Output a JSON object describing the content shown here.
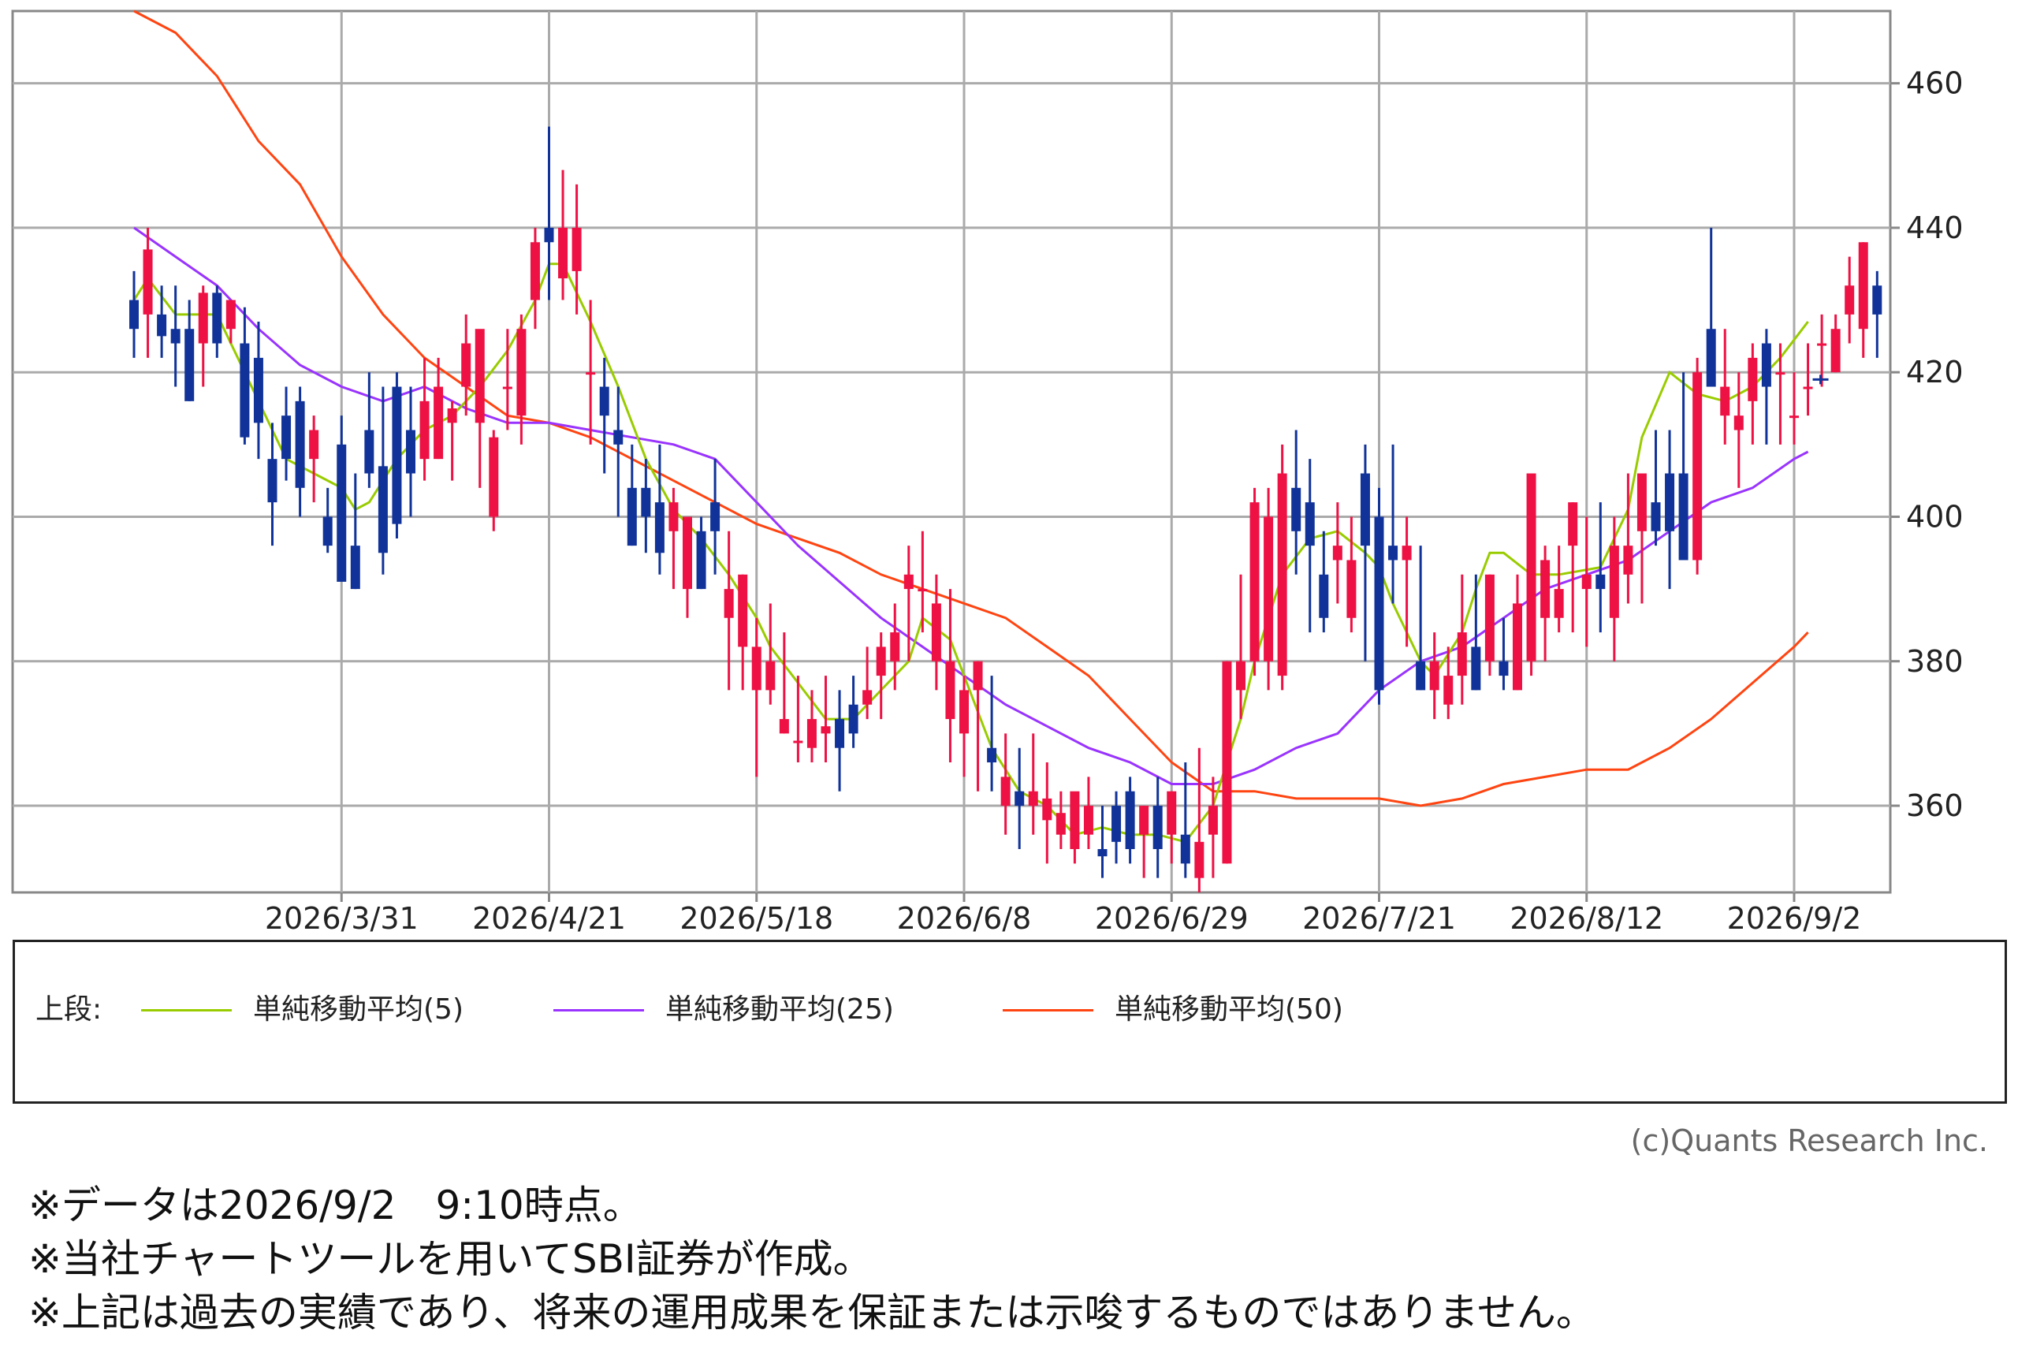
{
  "chart_data": {
    "type": "candlestick",
    "y_axis": {
      "range": [
        348,
        470
      ],
      "ticks": [
        360,
        380,
        400,
        420,
        440,
        460
      ],
      "position": "right"
    },
    "x_axis": {
      "tick_labels": [
        "2026/3/31",
        "2026/4/21",
        "2026/5/18",
        "2026/6/8",
        "2026/6/29",
        "2026/7/21",
        "2026/8/12",
        "2026/9/2"
      ],
      "tick_indices": [
        15,
        30,
        45,
        60,
        75,
        90,
        105,
        120
      ]
    },
    "grid": true,
    "colors": {
      "up": "#ee1144",
      "down": "#113399",
      "sma5": "#99cc00",
      "sma25": "#9933ff",
      "sma50": "#ff4411",
      "grid": "#aaaaaa"
    },
    "candles": [
      [
        430,
        434,
        422,
        426
      ],
      [
        428,
        440,
        422,
        437
      ],
      [
        428,
        432,
        422,
        425
      ],
      [
        426,
        432,
        418,
        424
      ],
      [
        426,
        430,
        416,
        416
      ],
      [
        424,
        432,
        418,
        431
      ],
      [
        431,
        432,
        422,
        424
      ],
      [
        426,
        430,
        424,
        430
      ],
      [
        424,
        429,
        410,
        411
      ],
      [
        422,
        427,
        408,
        413
      ],
      [
        408,
        413,
        396,
        402
      ],
      [
        414,
        418,
        405,
        408
      ],
      [
        416,
        418,
        400,
        404
      ],
      [
        408,
        414,
        402,
        412
      ],
      [
        400,
        404,
        395,
        396
      ],
      [
        410,
        414,
        396,
        391
      ],
      [
        396,
        406,
        390,
        390
      ],
      [
        412,
        420,
        404,
        406
      ],
      [
        407,
        418,
        392,
        395
      ],
      [
        418,
        420,
        397,
        399
      ],
      [
        412,
        418,
        400,
        406
      ],
      [
        408,
        422,
        405,
        416
      ],
      [
        408,
        422,
        408,
        418
      ],
      [
        413,
        416,
        405,
        415
      ],
      [
        418,
        428,
        414,
        424
      ],
      [
        413,
        424,
        404,
        426
      ],
      [
        400,
        412,
        398,
        411
      ],
      [
        418,
        426,
        412,
        418
      ],
      [
        414,
        428,
        410,
        426
      ],
      [
        430,
        440,
        426,
        438
      ],
      [
        440,
        454,
        430,
        438
      ],
      [
        433,
        448,
        430,
        440
      ],
      [
        434,
        446,
        428,
        440
      ],
      [
        420,
        430,
        410,
        420
      ],
      [
        418,
        422,
        406,
        414
      ],
      [
        412,
        418,
        400,
        410
      ],
      [
        404,
        410,
        396,
        396
      ],
      [
        404,
        408,
        395,
        400
      ],
      [
        402,
        410,
        392,
        395
      ],
      [
        398,
        404,
        390,
        402
      ],
      [
        390,
        398,
        386,
        400
      ],
      [
        398,
        400,
        390,
        390
      ],
      [
        402,
        408,
        392,
        398
      ],
      [
        386,
        398,
        376,
        390
      ],
      [
        382,
        392,
        376,
        392
      ],
      [
        376,
        386,
        364,
        382
      ],
      [
        376,
        388,
        374,
        380
      ],
      [
        370,
        384,
        370,
        372
      ],
      [
        369,
        378,
        366,
        369
      ],
      [
        368,
        376,
        366,
        372
      ],
      [
        370,
        378,
        366,
        371
      ],
      [
        372,
        376,
        362,
        368
      ],
      [
        374,
        378,
        368,
        370
      ],
      [
        374,
        382,
        372,
        376
      ],
      [
        378,
        384,
        372,
        382
      ],
      [
        380,
        388,
        376,
        384
      ],
      [
        390,
        396,
        380,
        392
      ],
      [
        390,
        398,
        384,
        390
      ],
      [
        380,
        392,
        376,
        388
      ],
      [
        372,
        390,
        366,
        380
      ],
      [
        370,
        378,
        364,
        376
      ],
      [
        376,
        380,
        362,
        380
      ],
      [
        368,
        378,
        362,
        366
      ],
      [
        360,
        370,
        356,
        364
      ],
      [
        362,
        368,
        354,
        360
      ],
      [
        360,
        370,
        356,
        362
      ],
      [
        358,
        366,
        352,
        361
      ],
      [
        356,
        362,
        354,
        359
      ],
      [
        354,
        360,
        352,
        362
      ],
      [
        356,
        364,
        354,
        360
      ],
      [
        354,
        360,
        350,
        353
      ],
      [
        360,
        362,
        352,
        355
      ],
      [
        362,
        364,
        352,
        354
      ],
      [
        356,
        360,
        350,
        360
      ],
      [
        360,
        364,
        350,
        354
      ],
      [
        356,
        362,
        352,
        362
      ],
      [
        356,
        366,
        350,
        352
      ],
      [
        350,
        368,
        348,
        355
      ],
      [
        356,
        364,
        350,
        360
      ],
      [
        352,
        380,
        352,
        380
      ],
      [
        376,
        392,
        372,
        380
      ],
      [
        380,
        404,
        378,
        402
      ],
      [
        380,
        404,
        376,
        400
      ],
      [
        378,
        410,
        376,
        406
      ],
      [
        404,
        412,
        392,
        398
      ],
      [
        402,
        408,
        384,
        396
      ],
      [
        392,
        398,
        384,
        386
      ],
      [
        394,
        402,
        388,
        396
      ],
      [
        386,
        400,
        384,
        394
      ],
      [
        406,
        410,
        380,
        396
      ],
      [
        400,
        404,
        374,
        376
      ],
      [
        396,
        410,
        388,
        394
      ],
      [
        394,
        400,
        382,
        396
      ],
      [
        380,
        396,
        376,
        376
      ],
      [
        376,
        384,
        372,
        380
      ],
      [
        374,
        382,
        372,
        378
      ],
      [
        378,
        392,
        374,
        384
      ],
      [
        382,
        392,
        376,
        376
      ],
      [
        380,
        392,
        378,
        392
      ],
      [
        380,
        386,
        376,
        378
      ],
      [
        376,
        392,
        376,
        388
      ],
      [
        380,
        396,
        378,
        406
      ],
      [
        386,
        396,
        380,
        394
      ],
      [
        386,
        396,
        384,
        390
      ],
      [
        396,
        402,
        384,
        402
      ],
      [
        390,
        400,
        382,
        392
      ],
      [
        392,
        402,
        384,
        390
      ],
      [
        386,
        400,
        380,
        396
      ],
      [
        392,
        406,
        388,
        396
      ],
      [
        398,
        404,
        388,
        406
      ],
      [
        402,
        412,
        396,
        398
      ],
      [
        406,
        412,
        390,
        398
      ],
      [
        406,
        420,
        396,
        394
      ],
      [
        394,
        422,
        392,
        420
      ],
      [
        426,
        440,
        418,
        418
      ],
      [
        414,
        426,
        410,
        418
      ],
      [
        412,
        420,
        404,
        414
      ],
      [
        416,
        424,
        410,
        422
      ],
      [
        424,
        426,
        410,
        418
      ],
      [
        420,
        424,
        410,
        420
      ],
      [
        414,
        420,
        410,
        414
      ],
      [
        418,
        424,
        414,
        418
      ],
      [
        424,
        428,
        418,
        424
      ],
      [
        420,
        428,
        420,
        426
      ],
      [
        428,
        436,
        424,
        432
      ],
      [
        426,
        438,
        422,
        438
      ],
      [
        432,
        434,
        422,
        428
      ]
    ],
    "sma5": [
      [
        0,
        430
      ],
      [
        1,
        433
      ],
      [
        3,
        428
      ],
      [
        5,
        428
      ],
      [
        6,
        428
      ],
      [
        8,
        420
      ],
      [
        10,
        412
      ],
      [
        11,
        408
      ],
      [
        13,
        406
      ],
      [
        15,
        404
      ],
      [
        16,
        401
      ],
      [
        17,
        402
      ],
      [
        19,
        408
      ],
      [
        21,
        412
      ],
      [
        23,
        414
      ],
      [
        25,
        418
      ],
      [
        27,
        423
      ],
      [
        29,
        430
      ],
      [
        30,
        435
      ],
      [
        31,
        435
      ],
      [
        33,
        427
      ],
      [
        35,
        418
      ],
      [
        37,
        408
      ],
      [
        39,
        401
      ],
      [
        41,
        397
      ],
      [
        43,
        392
      ],
      [
        45,
        386
      ],
      [
        46,
        382
      ],
      [
        48,
        377
      ],
      [
        50,
        372
      ],
      [
        52,
        372
      ],
      [
        54,
        376
      ],
      [
        56,
        380
      ],
      [
        57,
        386
      ],
      [
        59,
        383
      ],
      [
        60,
        378
      ],
      [
        61,
        373
      ],
      [
        62,
        368
      ],
      [
        64,
        362
      ],
      [
        66,
        360
      ],
      [
        68,
        356
      ],
      [
        70,
        357
      ],
      [
        72,
        356
      ],
      [
        74,
        356
      ],
      [
        76,
        355
      ],
      [
        78,
        360
      ],
      [
        80,
        372
      ],
      [
        81,
        380
      ],
      [
        83,
        392
      ],
      [
        85,
        397
      ],
      [
        87,
        398
      ],
      [
        89,
        395
      ],
      [
        90,
        393
      ],
      [
        91,
        388
      ],
      [
        92,
        384
      ],
      [
        93,
        380
      ],
      [
        94,
        378
      ],
      [
        96,
        384
      ],
      [
        97,
        390
      ],
      [
        98,
        395
      ],
      [
        99,
        395
      ],
      [
        101,
        392
      ],
      [
        103,
        392
      ],
      [
        106,
        393
      ],
      [
        108,
        401
      ],
      [
        109,
        411
      ],
      [
        111,
        420
      ],
      [
        113,
        417
      ],
      [
        115,
        416
      ],
      [
        117,
        418
      ],
      [
        119,
        422
      ],
      [
        121,
        427
      ]
    ],
    "sma25": [
      [
        0,
        440
      ],
      [
        3,
        436
      ],
      [
        6,
        432
      ],
      [
        9,
        426
      ],
      [
        12,
        421
      ],
      [
        15,
        418
      ],
      [
        18,
        416
      ],
      [
        21,
        418
      ],
      [
        24,
        415
      ],
      [
        27,
        413
      ],
      [
        30,
        413
      ],
      [
        33,
        412
      ],
      [
        36,
        411
      ],
      [
        39,
        410
      ],
      [
        42,
        408
      ],
      [
        45,
        402
      ],
      [
        48,
        396
      ],
      [
        51,
        391
      ],
      [
        54,
        386
      ],
      [
        57,
        382
      ],
      [
        60,
        378
      ],
      [
        63,
        374
      ],
      [
        66,
        371
      ],
      [
        69,
        368
      ],
      [
        72,
        366
      ],
      [
        75,
        363
      ],
      [
        78,
        363
      ],
      [
        81,
        365
      ],
      [
        84,
        368
      ],
      [
        87,
        370
      ],
      [
        90,
        376
      ],
      [
        93,
        380
      ],
      [
        96,
        382
      ],
      [
        99,
        386
      ],
      [
        102,
        390
      ],
      [
        105,
        392
      ],
      [
        108,
        394
      ],
      [
        111,
        398
      ],
      [
        114,
        402
      ],
      [
        117,
        404
      ],
      [
        120,
        408
      ],
      [
        121,
        409
      ]
    ],
    "sma50": [
      [
        0,
        470
      ],
      [
        3,
        467
      ],
      [
        6,
        461
      ],
      [
        9,
        452
      ],
      [
        12,
        446
      ],
      [
        15,
        436
      ],
      [
        18,
        428
      ],
      [
        21,
        422
      ],
      [
        24,
        418
      ],
      [
        27,
        414
      ],
      [
        30,
        413
      ],
      [
        33,
        411
      ],
      [
        36,
        408
      ],
      [
        39,
        405
      ],
      [
        42,
        402
      ],
      [
        45,
        399
      ],
      [
        48,
        397
      ],
      [
        51,
        395
      ],
      [
        54,
        392
      ],
      [
        57,
        390
      ],
      [
        60,
        388
      ],
      [
        63,
        386
      ],
      [
        66,
        382
      ],
      [
        69,
        378
      ],
      [
        72,
        372
      ],
      [
        75,
        366
      ],
      [
        78,
        362
      ],
      [
        81,
        362
      ],
      [
        84,
        361
      ],
      [
        87,
        361
      ],
      [
        90,
        361
      ],
      [
        93,
        360
      ],
      [
        96,
        361
      ],
      [
        99,
        363
      ],
      [
        102,
        364
      ],
      [
        105,
        365
      ],
      [
        108,
        365
      ],
      [
        111,
        368
      ],
      [
        114,
        372
      ],
      [
        117,
        377
      ],
      [
        120,
        382
      ],
      [
        121,
        384
      ]
    ],
    "last_price_marker": [
      121,
      419
    ]
  },
  "legend": {
    "prefix": "上段:",
    "items": [
      {
        "label": "単純移動平均(5)",
        "color": "#99cc00"
      },
      {
        "label": "単純移動平均(25)",
        "color": "#9933ff"
      },
      {
        "label": "単純移動平均(50)",
        "color": "#ff4411"
      }
    ]
  },
  "copyright": "(c)Quants Research Inc.",
  "notes": [
    "※データは2026/9/2　9:10時点。",
    "※当社チャートツールを用いてSBI証券が作成。",
    "※上記は過去の実績であり、将来の運用成果を保証または示唆するものではありません。"
  ]
}
